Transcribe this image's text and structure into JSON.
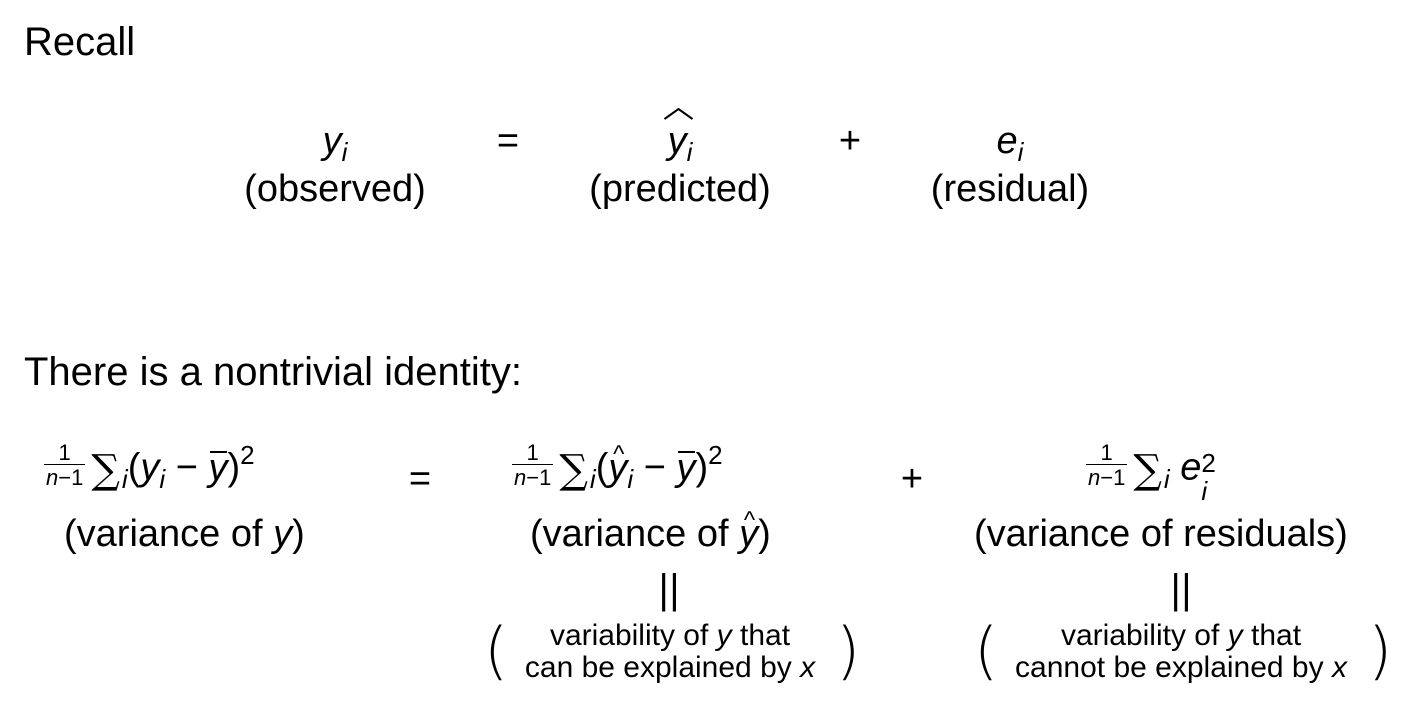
{
  "recall": {
    "heading": "Recall",
    "observed_label": "(observed)",
    "predicted_label": "(predicted)",
    "residual_label": "(residual)",
    "equals": "=",
    "plus": "+",
    "y_symbol": "y",
    "e_symbol": "e",
    "index": "i"
  },
  "identity": {
    "heading": "There is a nontrivial identity:",
    "fraction_numerator": "1",
    "fraction_denominator_n": "n",
    "fraction_denominator_rest": "−1",
    "sum_symbol": "∑",
    "equals": "=",
    "plus": "+",
    "exponent": "2",
    "variance_y_label_prefix": "(variance of ",
    "variance_y_label_var": "y",
    "variance_yhat_label_prefix": "(variance of ",
    "variance_yhat_label_var": "y",
    "variance_residuals_label": "(variance of residuals)",
    "double_bar": "||",
    "explained_line1_prefix": "variability of ",
    "explained_line1_var": "y",
    "explained_line1_suffix": " that",
    "explained_line2_prefix": "can be explained by ",
    "explained_line2_var": "x",
    "unexplained_line1_prefix": "variability of ",
    "unexplained_line1_var": "y",
    "unexplained_line1_suffix": " that",
    "unexplained_line2_prefix": "cannot be explained by ",
    "unexplained_line2_var": "x",
    "left_paren": "(",
    "right_paren": ")",
    "close_paren": ")"
  }
}
